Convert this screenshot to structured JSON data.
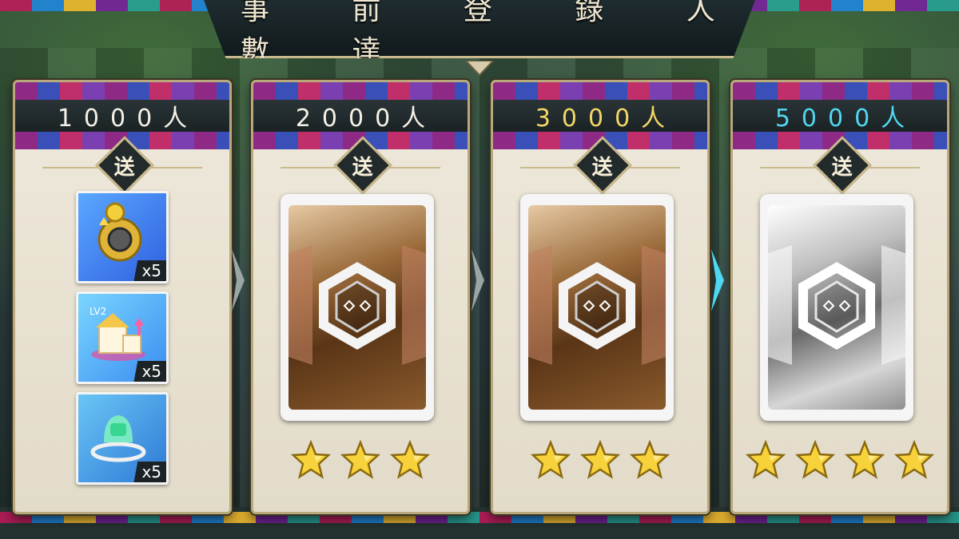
{
  "title": "事 前 登 錄 人 數 達",
  "send_label": "送",
  "milestones": [
    {
      "count": "1000人",
      "count_color": "white",
      "rewards": [
        {
          "icon": "gold-pouch-icon",
          "qty": "x5"
        },
        {
          "icon": "building-upgrade-lv2-icon",
          "badge": "LV2",
          "qty": "x5"
        },
        {
          "icon": "slime-capsule-icon",
          "qty": "x5"
        }
      ]
    },
    {
      "count": "2000人",
      "count_color": "white",
      "card": "bronze-character-card",
      "stars": 3
    },
    {
      "count": "3000人",
      "count_color": "gold",
      "card": "bronze-character-card",
      "stars": 3
    },
    {
      "count": "5000人",
      "count_color": "cyan",
      "card": "silver-character-card",
      "stars": 4
    }
  ],
  "colors": {
    "gold": "#f3d766",
    "cyan": "#4fd8f0",
    "frame": "#c9b98c"
  }
}
